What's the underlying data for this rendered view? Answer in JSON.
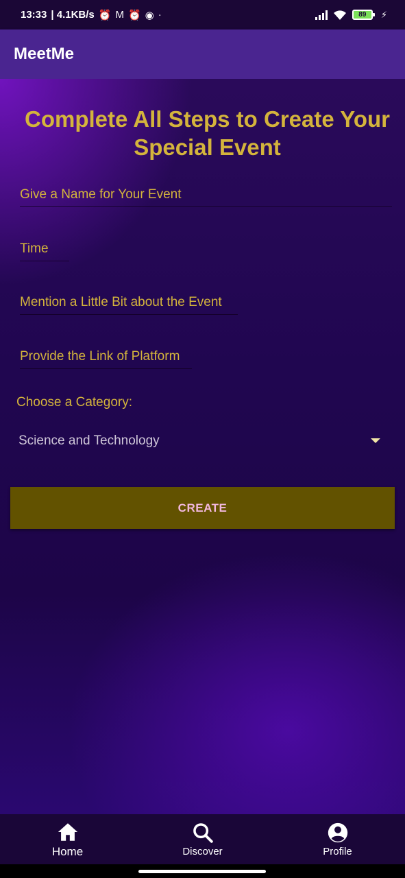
{
  "status_bar": {
    "time": "13:33",
    "network_speed": "| 4.1KB/s",
    "battery_level": "89",
    "icons": [
      "alarm-icon",
      "mail-icon",
      "alarm-icon",
      "app-icon",
      "dot-icon",
      "signal-icon",
      "wifi-icon",
      "battery-icon",
      "charging-icon"
    ]
  },
  "app_bar": {
    "title": "MeetMe"
  },
  "form": {
    "heading": "Complete All Steps to Create Your Special Event",
    "name_placeholder": "Give a Name for Your Event",
    "time_placeholder": "Time",
    "description_placeholder": "Mention  a Little Bit about the Event",
    "link_placeholder": "Provide the Link of Platform",
    "category_label": "Choose a Category:",
    "category_selected": "Science and Technology",
    "create_label": "CREATE"
  },
  "bottom_nav": {
    "items": [
      {
        "label": "Home",
        "icon": "home-icon",
        "active": true
      },
      {
        "label": "Discover",
        "icon": "search-icon",
        "active": false
      },
      {
        "label": "Profile",
        "icon": "profile-icon",
        "active": false
      }
    ]
  },
  "colors": {
    "accent_gold": "#d4b43c",
    "app_bar": "#4a2590",
    "button_bg": "#625200",
    "button_text": "#f2b8dd",
    "background": "#1a0638"
  }
}
